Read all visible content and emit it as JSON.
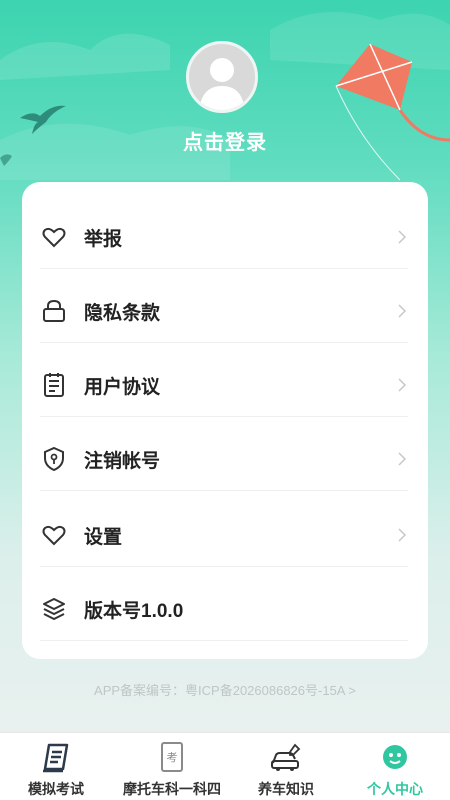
{
  "header": {
    "login_label": "点击登录"
  },
  "menu": [
    {
      "label": "举报",
      "icon": "heart-icon"
    },
    {
      "label": "隐私条款",
      "icon": "lock-icon"
    },
    {
      "label": "用户协议",
      "icon": "document-icon"
    },
    {
      "label": "注销帐号",
      "icon": "shield-icon"
    },
    {
      "label": "设置",
      "icon": "heart-icon"
    },
    {
      "label": "版本号1.0.0",
      "icon": "layers-icon"
    }
  ],
  "footer": {
    "icp": "APP备案编号：粤ICP备2026086826号-15A >"
  },
  "tabbar": [
    {
      "label": "模拟考试",
      "icon": "exam-book-icon",
      "active": false
    },
    {
      "label": "摩托车科一科四",
      "icon": "test-paper-icon",
      "active": false
    },
    {
      "label": "养车知识",
      "icon": "car-repair-icon",
      "active": false
    },
    {
      "label": "个人中心",
      "icon": "smiley-icon",
      "active": true
    }
  ],
  "colors": {
    "accent": "#2fc7a0",
    "kite": "#f07a62",
    "background_top": "#3dd4b0"
  }
}
